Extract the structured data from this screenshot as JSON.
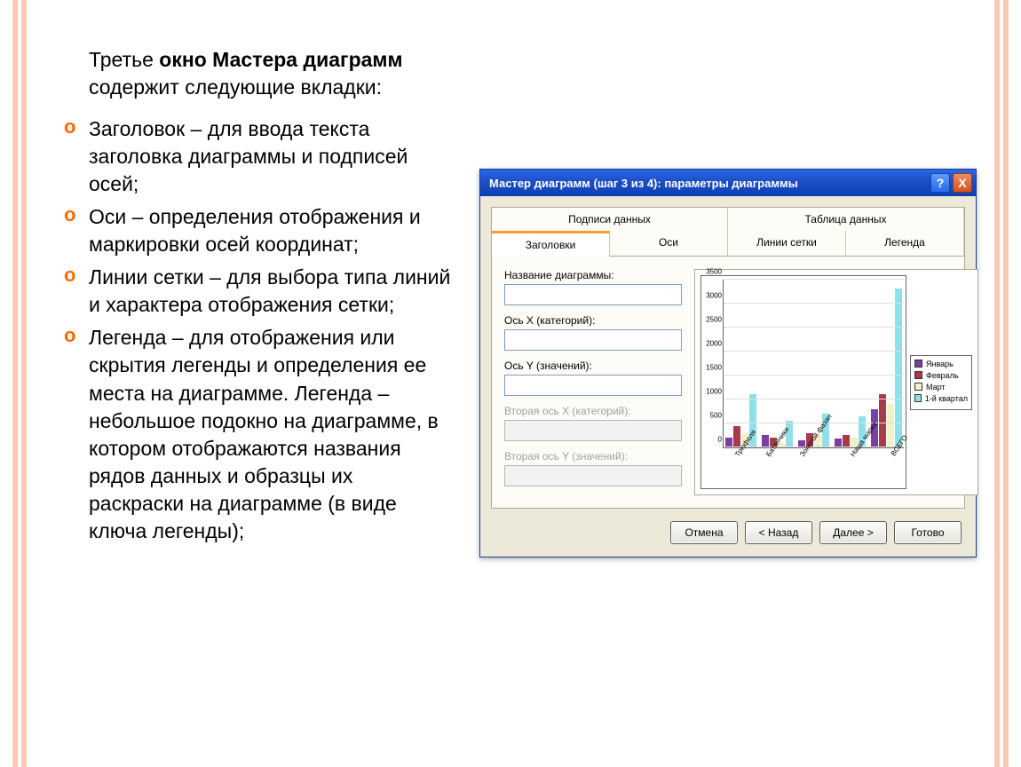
{
  "text": {
    "intro_plain_before": "Третье ",
    "intro_bold": "окно Мастера диаграмм",
    "intro_plain_after": " содержит следующие вкладки:",
    "bullets": [
      "Заголовок – для ввода текста заголовка диаграммы и подписей осей;",
      "Оси – определения отображения и маркировки осей координат;",
      "Линии сетки – для выбора типа линий и характера отображения сетки;",
      "Легенда – для отображения или скрытия легенды и определения ее места на диаграмме. Легенда – небольшое подокно на диаграмме, в котором отображаются названия рядов данных и образцы их раскраски на диаграмме (в виде ключа легенды);"
    ]
  },
  "window": {
    "title": "Мастер диаграмм (шаг 3 из 4): параметры диаграммы",
    "help": "?",
    "close": "X",
    "tabs_top": [
      "Подписи данных",
      "Таблица данных"
    ],
    "tabs_bottom": [
      "Заголовки",
      "Оси",
      "Линии сетки",
      "Легенда"
    ],
    "fields": {
      "chart_title": "Название диаграммы:",
      "axis_x": "Ось X (категорий):",
      "axis_y": "Ось Y (значений):",
      "axis_x2": "Вторая ось X (категорий):",
      "axis_y2": "Вторая ось Y (значений):"
    },
    "buttons": {
      "cancel": "Отмена",
      "back": "< Назад",
      "next": "Далее >",
      "finish": "Готово"
    }
  },
  "chart_data": {
    "type": "bar",
    "categories": [
      "Трюфеля",
      "Батончики",
      "Золотой фазан",
      "Наша марка",
      "ВСЕГО"
    ],
    "series": [
      {
        "name": "Январь",
        "color": "#7a3fa0",
        "values": [
          200,
          250,
          150,
          180,
          800
        ]
      },
      {
        "name": "Февраль",
        "color": "#a83b4a",
        "values": [
          450,
          200,
          300,
          250,
          1100
        ]
      },
      {
        "name": "Март",
        "color": "#f2f0c9",
        "values": [
          300,
          100,
          250,
          200,
          900
        ]
      },
      {
        "name": "1-й квартал",
        "color": "#8fe0e8",
        "values": [
          1100,
          550,
          700,
          650,
          3300
        ]
      }
    ],
    "ylim": [
      0,
      3500
    ],
    "yticks": [
      0,
      500,
      1000,
      1500,
      2000,
      2500,
      3000,
      3500
    ]
  }
}
